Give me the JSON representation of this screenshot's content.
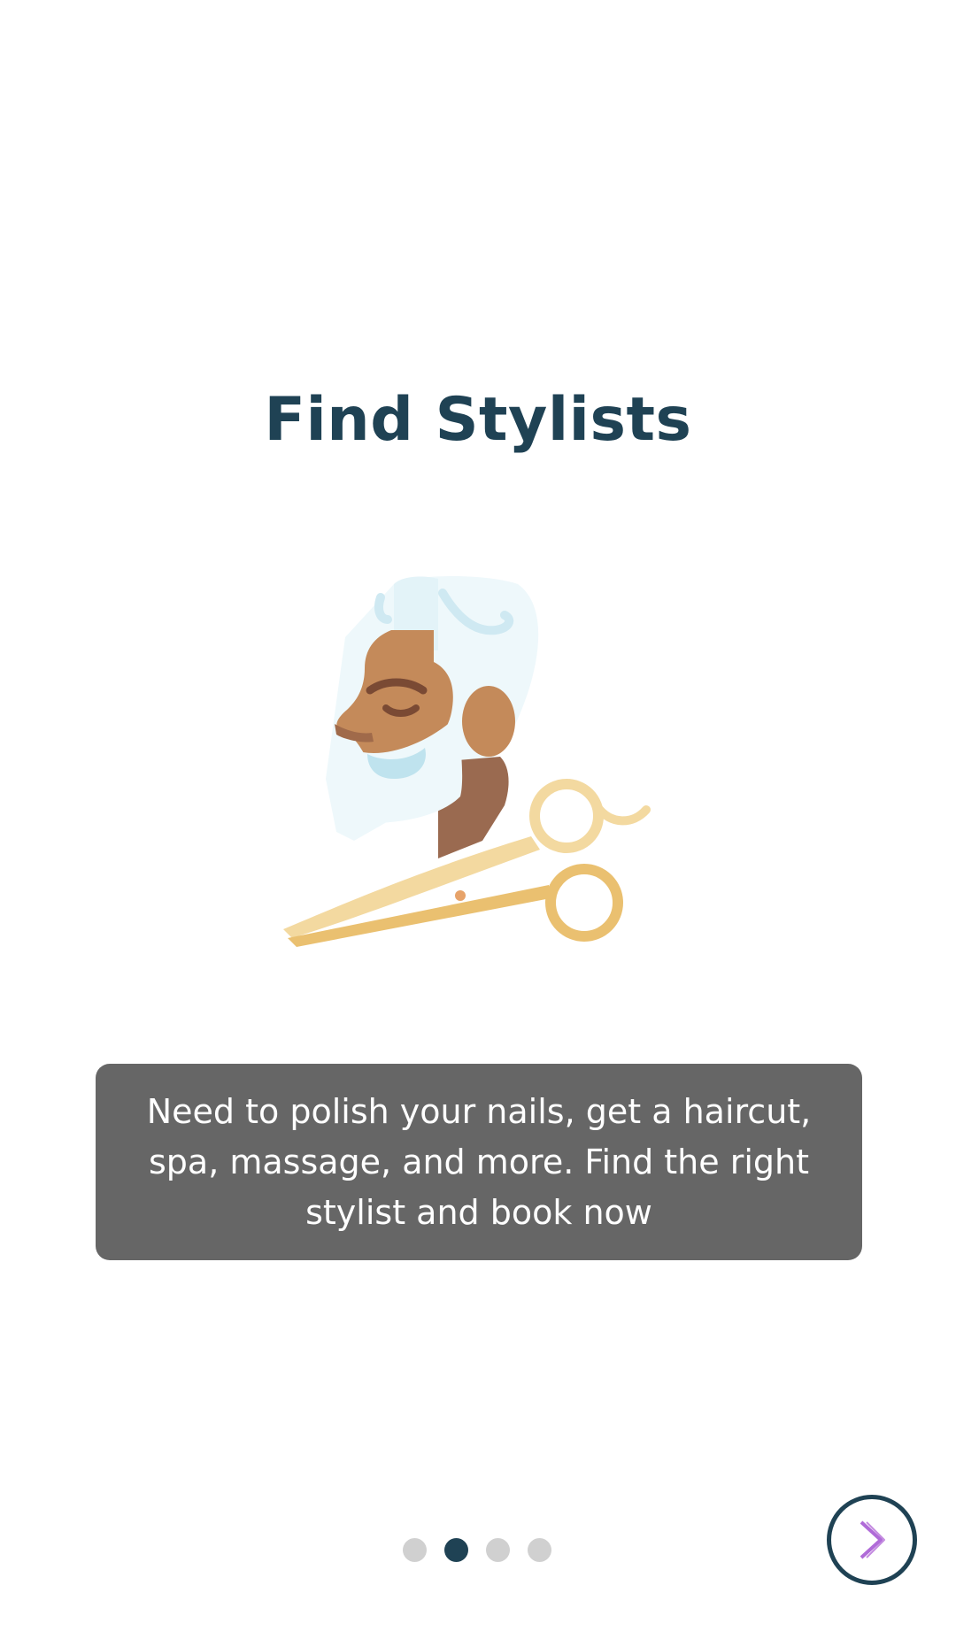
{
  "onboarding": {
    "title": "Find Stylists",
    "description": "Need to polish your nails, get a haircut, spa, massage, and more. Find the right stylist and book now",
    "illustration": "barber-with-scissors-icon",
    "page_indicator": {
      "total": 4,
      "current": 2
    },
    "next_button_icon": "chevron-right-icon"
  },
  "colors": {
    "title": "#1f4254",
    "description_bg": "#666666",
    "description_text": "#ffffff",
    "dot_active": "#1f4254",
    "dot_inactive": "#d0d0d0",
    "next_ring": "#1f4254",
    "next_chevron": "#b06bd8"
  }
}
